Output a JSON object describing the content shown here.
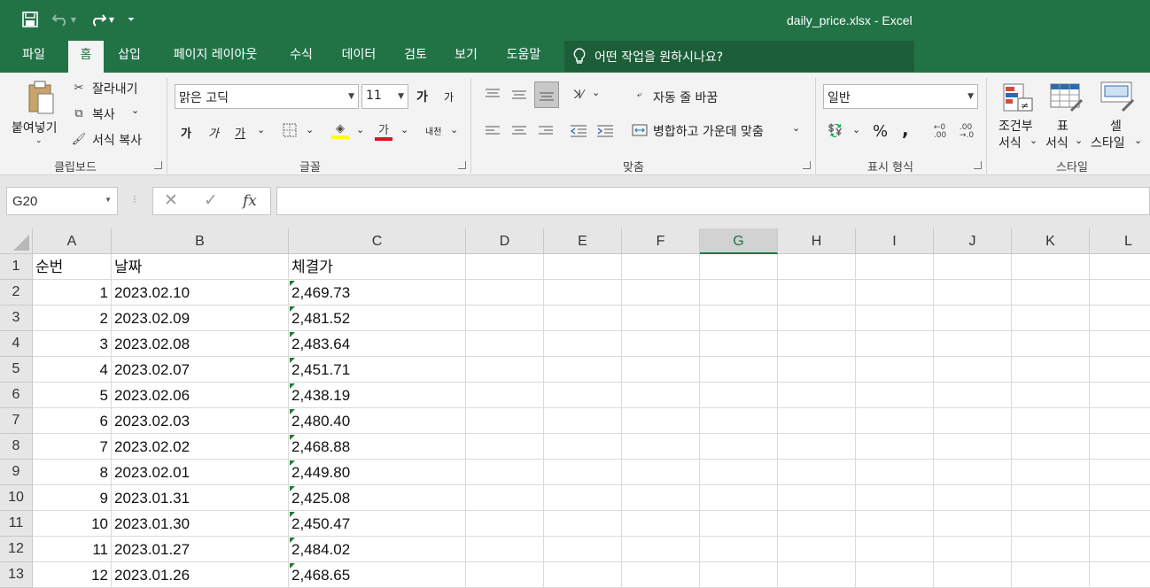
{
  "window": {
    "title": "daily_price.xlsx  -  Excel"
  },
  "tabs": [
    {
      "label": "파일",
      "active": false
    },
    {
      "label": "홈",
      "active": true
    },
    {
      "label": "삽입",
      "active": false
    },
    {
      "label": "페이지 레이아웃",
      "active": false
    },
    {
      "label": "수식",
      "active": false
    },
    {
      "label": "데이터",
      "active": false
    },
    {
      "label": "검토",
      "active": false
    },
    {
      "label": "보기",
      "active": false
    },
    {
      "label": "도움말",
      "active": false
    }
  ],
  "tellme": {
    "placeholder": "어떤 작업을 원하시나요?"
  },
  "ribbon": {
    "clipboard": {
      "paste": "붙여넣기",
      "cut": "잘라내기",
      "copy": "복사",
      "format_painter": "서식 복사",
      "label": "클립보드"
    },
    "font": {
      "name": "맑은 고딕",
      "size": "11",
      "label": "글꼴",
      "bold": "가",
      "italic": "가",
      "underline": "가",
      "grow": "가",
      "shrink": "가",
      "color": "가",
      "phonetic": "내천"
    },
    "alignment": {
      "wrap": "자동 줄 바꿈",
      "merge": "병합하고 가운데 맞춤",
      "label": "맞춤"
    },
    "number": {
      "format": "일반",
      "percent": "%",
      "comma": ",",
      "label": "표시 형식"
    },
    "styles": {
      "conditional_1": "조건부",
      "conditional_2": "서식",
      "table_1": "표",
      "table_2": "서식",
      "cell_1": "셀",
      "cell_2": "스타일",
      "label": "스타일"
    }
  },
  "formula_bar": {
    "name_box": "G20",
    "fx": "fx",
    "value": ""
  },
  "columns": [
    "A",
    "B",
    "C",
    "D",
    "E",
    "F",
    "G",
    "H",
    "I",
    "J",
    "K",
    "L"
  ],
  "selected_column": "G",
  "headers": {
    "a": "순번",
    "b": "날짜",
    "c": "체결가"
  },
  "rows": [
    {
      "n": "1",
      "a": "",
      "b": "",
      "c": ""
    },
    {
      "n": "2",
      "a": "1",
      "b": "2023.02.10",
      "c": "2,469.73"
    },
    {
      "n": "3",
      "a": "2",
      "b": "2023.02.09",
      "c": "2,481.52"
    },
    {
      "n": "4",
      "a": "3",
      "b": "2023.02.08",
      "c": "2,483.64"
    },
    {
      "n": "5",
      "a": "4",
      "b": "2023.02.07",
      "c": "2,451.71"
    },
    {
      "n": "6",
      "a": "5",
      "b": "2023.02.06",
      "c": "2,438.19"
    },
    {
      "n": "7",
      "a": "6",
      "b": "2023.02.03",
      "c": "2,480.40"
    },
    {
      "n": "8",
      "a": "7",
      "b": "2023.02.02",
      "c": "2,468.88"
    },
    {
      "n": "9",
      "a": "8",
      "b": "2023.02.01",
      "c": "2,449.80"
    },
    {
      "n": "10",
      "a": "9",
      "b": "2023.01.31",
      "c": "2,425.08"
    },
    {
      "n": "11",
      "a": "10",
      "b": "2023.01.30",
      "c": "2,450.47"
    },
    {
      "n": "12",
      "a": "11",
      "b": "2023.01.27",
      "c": "2,484.02"
    },
    {
      "n": "13",
      "a": "12",
      "b": "2023.01.26",
      "c": "2,468.65"
    }
  ],
  "colors": {
    "accent": "#217346",
    "error_triangle": "#1e7a32",
    "font_color": "#e81123",
    "highlight": "#ffff00"
  },
  "icons": [
    "save-icon",
    "undo-icon",
    "redo-icon",
    "lightbulb-icon",
    "cancel-icon",
    "enter-icon"
  ]
}
